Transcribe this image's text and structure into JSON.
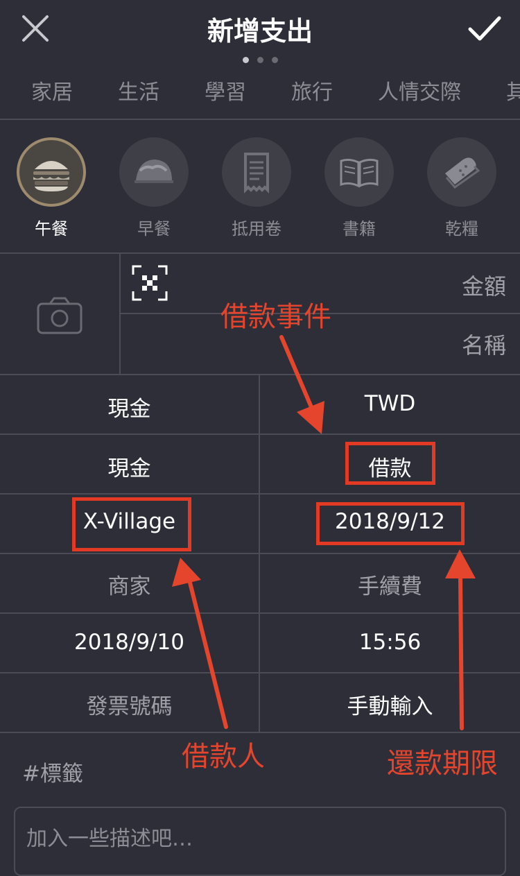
{
  "header": {
    "title": "新增支出",
    "pager": {
      "pages": 3,
      "active": 0
    }
  },
  "category_tabs": [
    "家居",
    "生活",
    "學習",
    "旅行",
    "人情交際",
    "其"
  ],
  "categories": [
    {
      "label": "午餐",
      "icon": "burger-icon",
      "selected": true
    },
    {
      "label": "早餐",
      "icon": "taco-icon",
      "selected": false
    },
    {
      "label": "抵用卷",
      "icon": "receipt-icon",
      "selected": false
    },
    {
      "label": "書籍",
      "icon": "book-icon",
      "selected": false
    },
    {
      "label": "乾糧",
      "icon": "toast-icon",
      "selected": false
    }
  ],
  "amount_label": "金額",
  "name_label": "名稱",
  "grid": {
    "account_from": "現金",
    "currency": "TWD",
    "account_to": "現金",
    "loan_type": "借款",
    "borrower": "X-Village",
    "due_date": "2018/9/12",
    "merchant": "商家",
    "fee": "手續費",
    "date": "2018/9/10",
    "time": "15:56",
    "invoice": "發票號碼",
    "input_mode": "手動輸入"
  },
  "tags_label": "#標籤",
  "description_placeholder": "加入一些描述吧…",
  "annotations": {
    "loan_event": "借款事件",
    "borrower": "借款人",
    "due": "還款期限"
  },
  "colors": {
    "background": "#2e2e38",
    "annotation": "#e5452d",
    "selected_ring": "#9e8a6c"
  }
}
